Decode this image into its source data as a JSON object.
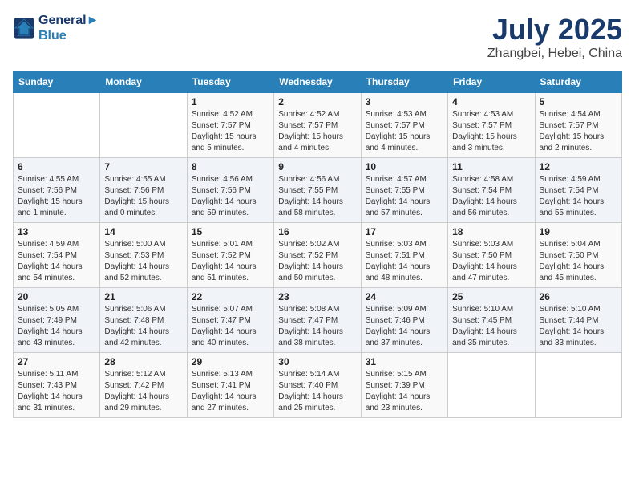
{
  "logo": {
    "line1": "General",
    "line2": "Blue"
  },
  "title": "July 2025",
  "location": "Zhangbei, Hebei, China",
  "days_of_week": [
    "Sunday",
    "Monday",
    "Tuesday",
    "Wednesday",
    "Thursday",
    "Friday",
    "Saturday"
  ],
  "weeks": [
    [
      {
        "day": "",
        "info": ""
      },
      {
        "day": "",
        "info": ""
      },
      {
        "day": "1",
        "info": "Sunrise: 4:52 AM\nSunset: 7:57 PM\nDaylight: 15 hours\nand 5 minutes."
      },
      {
        "day": "2",
        "info": "Sunrise: 4:52 AM\nSunset: 7:57 PM\nDaylight: 15 hours\nand 4 minutes."
      },
      {
        "day": "3",
        "info": "Sunrise: 4:53 AM\nSunset: 7:57 PM\nDaylight: 15 hours\nand 4 minutes."
      },
      {
        "day": "4",
        "info": "Sunrise: 4:53 AM\nSunset: 7:57 PM\nDaylight: 15 hours\nand 3 minutes."
      },
      {
        "day": "5",
        "info": "Sunrise: 4:54 AM\nSunset: 7:57 PM\nDaylight: 15 hours\nand 2 minutes."
      }
    ],
    [
      {
        "day": "6",
        "info": "Sunrise: 4:55 AM\nSunset: 7:56 PM\nDaylight: 15 hours\nand 1 minute."
      },
      {
        "day": "7",
        "info": "Sunrise: 4:55 AM\nSunset: 7:56 PM\nDaylight: 15 hours\nand 0 minutes."
      },
      {
        "day": "8",
        "info": "Sunrise: 4:56 AM\nSunset: 7:56 PM\nDaylight: 14 hours\nand 59 minutes."
      },
      {
        "day": "9",
        "info": "Sunrise: 4:56 AM\nSunset: 7:55 PM\nDaylight: 14 hours\nand 58 minutes."
      },
      {
        "day": "10",
        "info": "Sunrise: 4:57 AM\nSunset: 7:55 PM\nDaylight: 14 hours\nand 57 minutes."
      },
      {
        "day": "11",
        "info": "Sunrise: 4:58 AM\nSunset: 7:54 PM\nDaylight: 14 hours\nand 56 minutes."
      },
      {
        "day": "12",
        "info": "Sunrise: 4:59 AM\nSunset: 7:54 PM\nDaylight: 14 hours\nand 55 minutes."
      }
    ],
    [
      {
        "day": "13",
        "info": "Sunrise: 4:59 AM\nSunset: 7:54 PM\nDaylight: 14 hours\nand 54 minutes."
      },
      {
        "day": "14",
        "info": "Sunrise: 5:00 AM\nSunset: 7:53 PM\nDaylight: 14 hours\nand 52 minutes."
      },
      {
        "day": "15",
        "info": "Sunrise: 5:01 AM\nSunset: 7:52 PM\nDaylight: 14 hours\nand 51 minutes."
      },
      {
        "day": "16",
        "info": "Sunrise: 5:02 AM\nSunset: 7:52 PM\nDaylight: 14 hours\nand 50 minutes."
      },
      {
        "day": "17",
        "info": "Sunrise: 5:03 AM\nSunset: 7:51 PM\nDaylight: 14 hours\nand 48 minutes."
      },
      {
        "day": "18",
        "info": "Sunrise: 5:03 AM\nSunset: 7:50 PM\nDaylight: 14 hours\nand 47 minutes."
      },
      {
        "day": "19",
        "info": "Sunrise: 5:04 AM\nSunset: 7:50 PM\nDaylight: 14 hours\nand 45 minutes."
      }
    ],
    [
      {
        "day": "20",
        "info": "Sunrise: 5:05 AM\nSunset: 7:49 PM\nDaylight: 14 hours\nand 43 minutes."
      },
      {
        "day": "21",
        "info": "Sunrise: 5:06 AM\nSunset: 7:48 PM\nDaylight: 14 hours\nand 42 minutes."
      },
      {
        "day": "22",
        "info": "Sunrise: 5:07 AM\nSunset: 7:47 PM\nDaylight: 14 hours\nand 40 minutes."
      },
      {
        "day": "23",
        "info": "Sunrise: 5:08 AM\nSunset: 7:47 PM\nDaylight: 14 hours\nand 38 minutes."
      },
      {
        "day": "24",
        "info": "Sunrise: 5:09 AM\nSunset: 7:46 PM\nDaylight: 14 hours\nand 37 minutes."
      },
      {
        "day": "25",
        "info": "Sunrise: 5:10 AM\nSunset: 7:45 PM\nDaylight: 14 hours\nand 35 minutes."
      },
      {
        "day": "26",
        "info": "Sunrise: 5:10 AM\nSunset: 7:44 PM\nDaylight: 14 hours\nand 33 minutes."
      }
    ],
    [
      {
        "day": "27",
        "info": "Sunrise: 5:11 AM\nSunset: 7:43 PM\nDaylight: 14 hours\nand 31 minutes."
      },
      {
        "day": "28",
        "info": "Sunrise: 5:12 AM\nSunset: 7:42 PM\nDaylight: 14 hours\nand 29 minutes."
      },
      {
        "day": "29",
        "info": "Sunrise: 5:13 AM\nSunset: 7:41 PM\nDaylight: 14 hours\nand 27 minutes."
      },
      {
        "day": "30",
        "info": "Sunrise: 5:14 AM\nSunset: 7:40 PM\nDaylight: 14 hours\nand 25 minutes."
      },
      {
        "day": "31",
        "info": "Sunrise: 5:15 AM\nSunset: 7:39 PM\nDaylight: 14 hours\nand 23 minutes."
      },
      {
        "day": "",
        "info": ""
      },
      {
        "day": "",
        "info": ""
      }
    ]
  ]
}
